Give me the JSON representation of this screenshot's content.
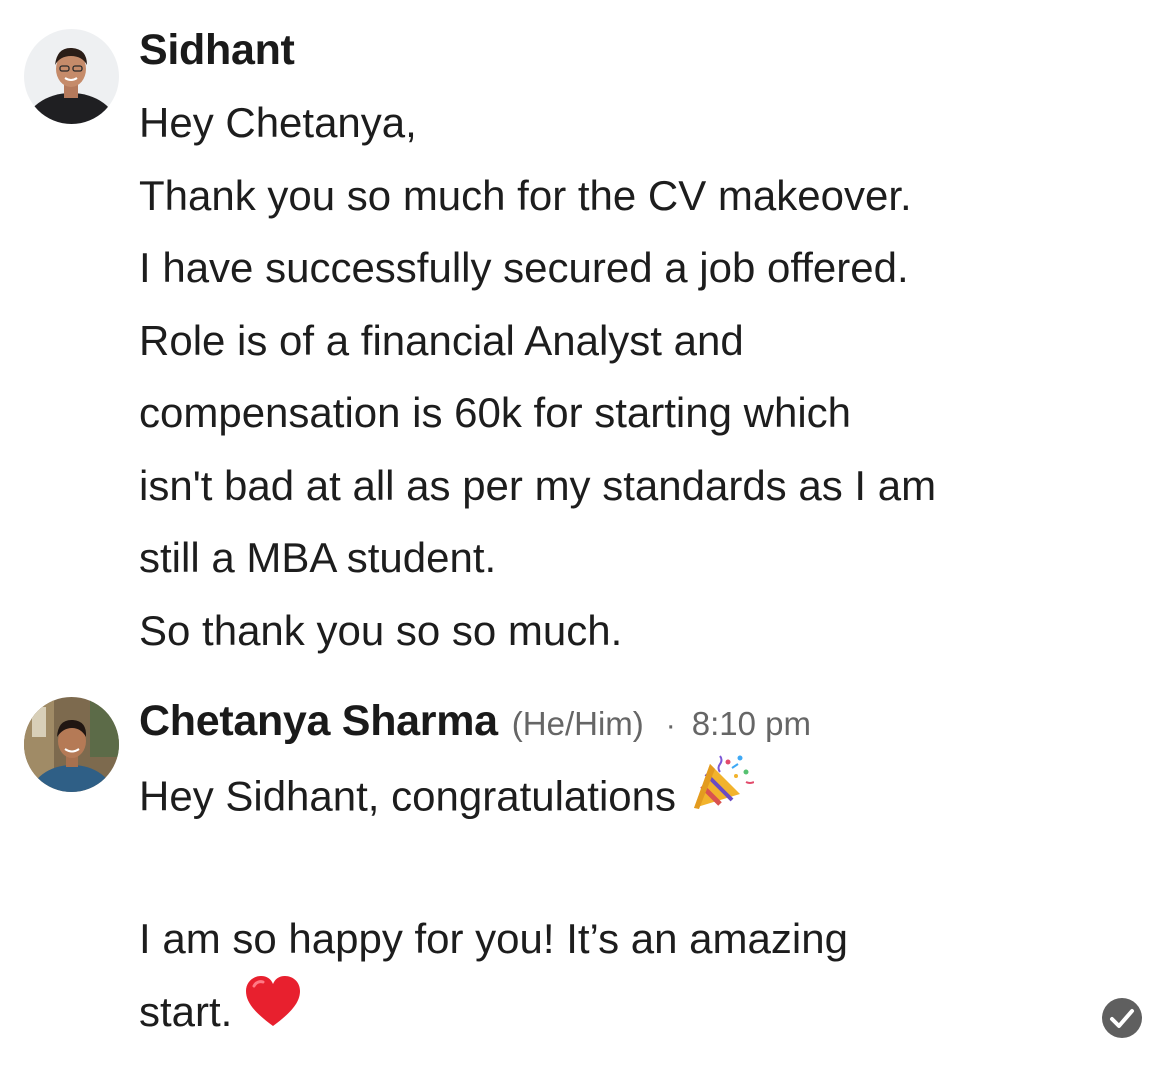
{
  "messages": [
    {
      "sender": "Sidhant",
      "lines": [
        "Hey Chetanya,",
        "Thank you so much for the CV makeover.",
        "I have successfully secured a job offered.",
        "Role is of a financial Analyst and",
        "compensation is 60k for starting which",
        "isn't bad at all as per my standards as I am",
        "still a MBA student.",
        "So thank you so so much."
      ]
    },
    {
      "sender": "Chetanya Sharma",
      "pronouns": "(He/Him)",
      "separator": "·",
      "time": "8:10 pm",
      "lines": [
        "Hey Sidhant, congratulations",
        "",
        "I am so happy for you! It’s an amazing",
        "start."
      ],
      "emojis": [
        "party-popper",
        "red-heart"
      ]
    }
  ],
  "status": {
    "icon": "read-receipt-check-icon"
  },
  "colors": {
    "text": "#1d1d1d",
    "meta": "#666666",
    "heart": "#e8202e",
    "check": "#5f5f5f"
  }
}
